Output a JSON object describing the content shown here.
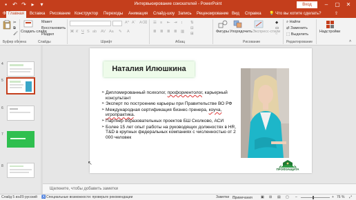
{
  "window": {
    "title": "Интервьюирование соискателей  -  PowerPoint",
    "signin_label": "Вход",
    "minimize": "–",
    "restore": "▢",
    "close": "✕"
  },
  "tabs": [
    {
      "label": "Файл"
    },
    {
      "label": "Главная"
    },
    {
      "label": "Вставка"
    },
    {
      "label": "Рисование"
    },
    {
      "label": "Конструктор"
    },
    {
      "label": "Переходы"
    },
    {
      "label": "Анимация"
    },
    {
      "label": "Слайд-шоу"
    },
    {
      "label": "Запись"
    },
    {
      "label": "Рецензирование"
    },
    {
      "label": "Вид"
    },
    {
      "label": "Справка"
    }
  ],
  "tell_me": "Что вы хотите сделать?",
  "share": "Общий доступ",
  "ribbon": {
    "paste": "Вставить",
    "create_slide": "Создать слайд",
    "layout": "Макет",
    "reset": "Восстановить",
    "section": "Раздел",
    "clipboard_group": "Буфер обмена",
    "slides_group": "Слайды",
    "font_group": "Шрифт",
    "paragraph_group": "Абзац",
    "drawing_group": "Рисование",
    "editing_group": "Редактирование",
    "shapes": "Фигуры",
    "arrange": "Упорядочить",
    "quick_styles": "Экспресс-стили",
    "find": "Найти",
    "replace": "Заменить",
    "select": "Выделить",
    "designer": "Надстройки"
  },
  "thumbnails": {
    "numbers": [
      "4",
      "5",
      "6",
      "7",
      "8"
    ],
    "selected_index": 1
  },
  "slide": {
    "title": "Наталия Илюшкина",
    "bullets": [
      {
        "pre": "Дипломированный психолог, ",
        "err": "профориентолог",
        "post": ", карьерный консультант"
      },
      {
        "pre": "Эксперт по построению карьеры при Правительстве ВО РФ",
        "err": "",
        "post": ""
      },
      {
        "pre": "Международная сертификация бизнес-тренера, ",
        "err": "коуча, игропрактика",
        "post": "."
      },
      {
        "pre": "Партнер образовательных проектов БШ Сколково, АСИ",
        "err": "",
        "post": ""
      },
      {
        "pre": "Более 15 лет опыт работы на руководящих должностях в HR, T&D  в крупных  федеральных компаниях с численностью от 2 000 человек",
        "err": "",
        "post": ""
      }
    ],
    "logo_text": "ПРОФЗАЩИТА"
  },
  "notes_placeholder": "Щелкните, чтобы добавить заметки",
  "status": {
    "slide_counter": "Слайд 5 из 29",
    "language": "русский",
    "accessibility": "Специальные возможности: проверьте рекомендации",
    "notes": "Заметки",
    "comments": "Примечания",
    "zoom": "76 %"
  },
  "colors": {
    "accent": "#c43e1c",
    "title_box": "#eefbea",
    "logo_green": "#1a6b2d"
  }
}
